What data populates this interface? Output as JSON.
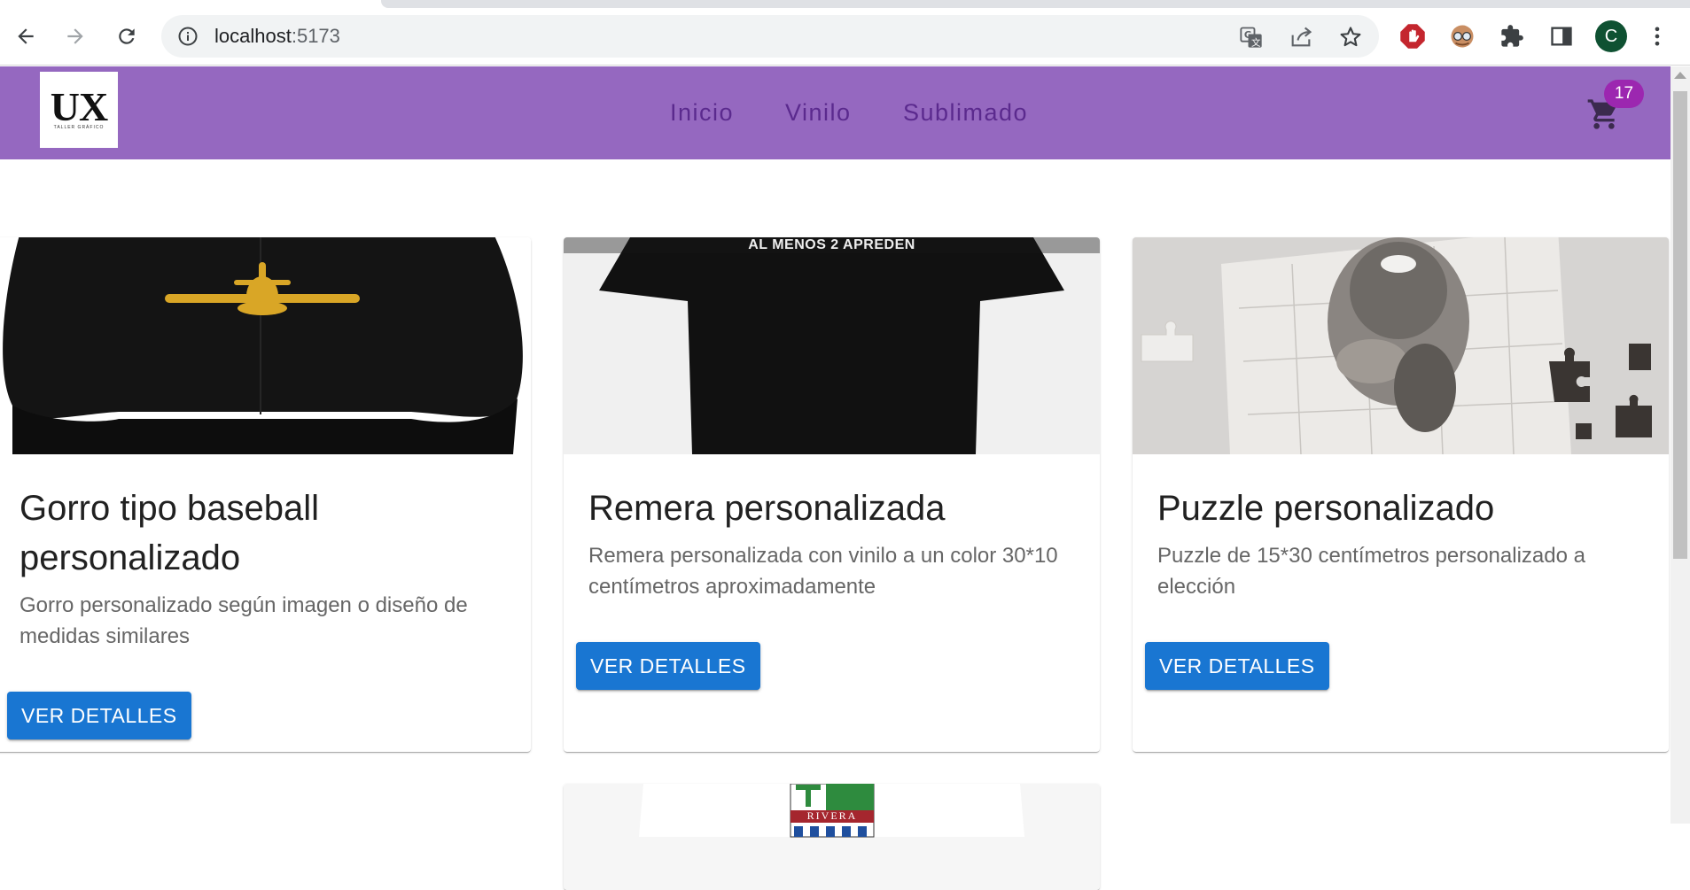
{
  "browser": {
    "url_host": "localhost",
    "url_port": ":5173",
    "profile_initial": "C",
    "icons": [
      "back-arrow-icon",
      "forward-arrow-icon",
      "reload-icon",
      "site-info-icon",
      "translate-icon",
      "share-icon",
      "bookmark-star-icon",
      "adblock-icon",
      "extension-avatar-icon",
      "puzzle-extensions-icon",
      "side-panel-icon",
      "kebab-menu-icon"
    ]
  },
  "appbar": {
    "logo_text": "UX",
    "logo_tagline": "TALLER GRÁFICO",
    "nav": [
      "Inicio",
      "Vinilo",
      "Sublimado"
    ],
    "cart_count": "17",
    "colors": {
      "bar": "#9568c0",
      "nav_text": "#5b2a8e",
      "badge": "#9c27b0"
    }
  },
  "products": [
    {
      "title": "Gorro tipo baseball personalizado",
      "description": "Gorro personalizado según imagen o diseño de medidas similares",
      "button": "VER DETALLES",
      "image": "black-cap-with-airplane"
    },
    {
      "title": "Remera personalizada",
      "description": "Remera personalizada con vinilo a un color 30*10 centímetros aproximadamente",
      "button": "VER DETALLES",
      "image": "black-tshirt",
      "image_text": "AL MENOS 2 APREDEN"
    },
    {
      "title": "Puzzle personalizado",
      "description": "Puzzle de 15*30 centímetros personalizado a elección",
      "button": "VER DETALLES",
      "image": "cat-puzzle"
    },
    {
      "image": "white-tshirt-rivera",
      "image_text": "RIVERA"
    }
  ],
  "accent": "#1976d2"
}
